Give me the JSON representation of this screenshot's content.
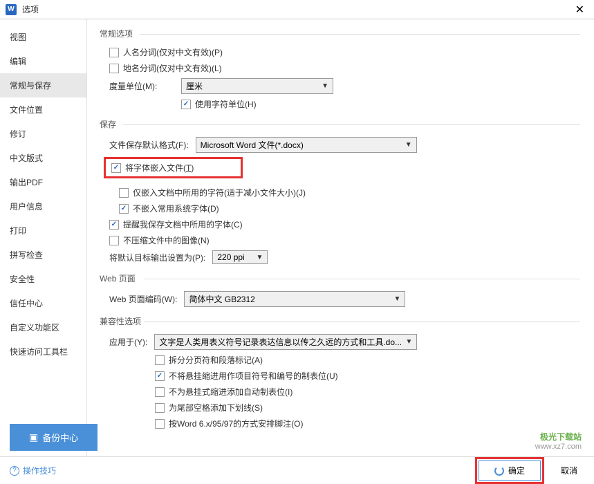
{
  "title": "选项",
  "sidebar": {
    "items": [
      {
        "label": "视图"
      },
      {
        "label": "编辑"
      },
      {
        "label": "常规与保存"
      },
      {
        "label": "文件位置"
      },
      {
        "label": "修订"
      },
      {
        "label": "中文版式"
      },
      {
        "label": "输出PDF"
      },
      {
        "label": "用户信息"
      },
      {
        "label": "打印"
      },
      {
        "label": "拼写检查"
      },
      {
        "label": "安全性"
      },
      {
        "label": "信任中心"
      },
      {
        "label": "自定义功能区"
      },
      {
        "label": "快速访问工具栏"
      }
    ]
  },
  "sections": {
    "general": {
      "title": "常规选项",
      "person_names": "人名分词(仅对中文有效)(P)",
      "place_names": "地名分词(仅对中文有效)(L)",
      "unit_label": "度量单位(M):",
      "unit_value": "厘米",
      "char_unit": "使用字符单位(H)"
    },
    "save": {
      "title": "保存",
      "default_format_label": "文件保存默认格式(F):",
      "default_format_value": "Microsoft Word 文件(*.docx)",
      "embed_fonts": "将字体嵌入文件(T)",
      "embed_used_only": "仅嵌入文档中所用的字符(适于减小文件大小)(J)",
      "no_embed_system": "不嵌入常用系统字体(D)",
      "remind_save_fonts": "提醒我保存文档中所用的字体(C)",
      "no_compress_images": "不压缩文件中的图像(N)",
      "default_target_label": "将默认目标输出设置为(P):",
      "default_target_value": "220 ppi"
    },
    "web": {
      "title": "Web 页面",
      "encoding_label": "Web 页面编码(W):",
      "encoding_value": "简体中文 GB2312"
    },
    "compat": {
      "title": "兼容性选项",
      "apply_to_label": "应用于(Y):",
      "apply_to_value": "文字是人类用表义符号记录表达信息以传之久远的方式和工具.do...",
      "split_page": "拆分分页符和段落标记(A)",
      "no_hanging_indent": "不将悬挂缩进用作项目符号和编号的制表位(U)",
      "no_hanging_tab": "不为悬挂式缩进添加自动制表位(I)",
      "underline_trailing": "为尾部空格添加下划线(S)",
      "word6_footnote": "按Word 6.x/95/97的方式安排脚注(O)"
    }
  },
  "footer": {
    "backup": "备份中心",
    "tips": "操作技巧",
    "ok": "确定",
    "cancel": "取消"
  },
  "watermark": {
    "line1": "极光下载站",
    "line2": "www.xz7.com"
  }
}
